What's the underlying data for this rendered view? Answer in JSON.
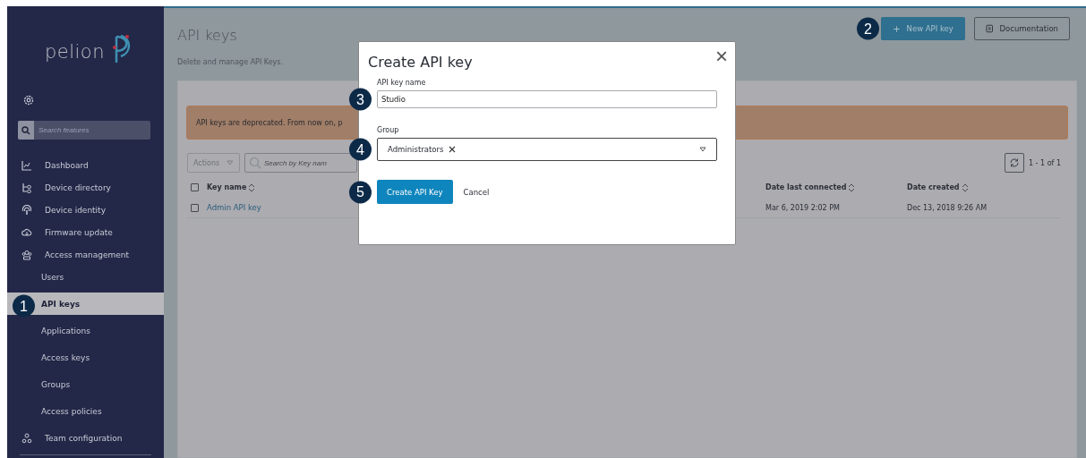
{
  "sidebar": {
    "logo": "pelion",
    "search": {
      "placeholder": "Search features"
    },
    "items": [
      {
        "label": "Dashboard",
        "selected": false
      },
      {
        "label": "Device directory",
        "selected": false
      },
      {
        "label": "Device identity",
        "selected": false
      },
      {
        "label": "Firmware update",
        "selected": false
      },
      {
        "label": "Access management",
        "selected": false,
        "children": [
          {
            "label": "Users",
            "selected": false
          },
          {
            "label": "API keys",
            "selected": true,
            "callout": "1"
          },
          {
            "label": "Applications",
            "selected": false
          },
          {
            "label": "Access keys",
            "selected": false
          },
          {
            "label": "Groups",
            "selected": false
          },
          {
            "label": "Access policies",
            "selected": false
          }
        ]
      },
      {
        "label": "Team configuration",
        "selected": false
      }
    ]
  },
  "header": {
    "title": "API keys",
    "subtitle": "Delete and manage API Keys.",
    "buttons": [
      {
        "label": "New API key",
        "kind": "primary",
        "icon": "+",
        "callout": "2"
      },
      {
        "label": "Documentation",
        "kind": "secondary"
      }
    ]
  },
  "warning": "API keys are deprecated. From now on, p",
  "toolbar": {
    "actions": "Actions",
    "search": {
      "placeholder": "Search by Key nam"
    },
    "pagination": "1 - 1 of 1"
  },
  "table": {
    "all_checked": false,
    "columns": [
      {
        "label": "Key name"
      },
      {
        "label": "Date last connected"
      },
      {
        "label": "Date created"
      }
    ],
    "rows": [
      {
        "checked": false,
        "cells": [
          "Admin API key",
          "Mar 6, 2019 2:02 PM",
          "Dec 13, 2018 9:26 AM"
        ]
      }
    ]
  },
  "dialog": {
    "title": "Create API key",
    "close": "×",
    "fields": [
      {
        "kind": "text",
        "label": "API key name",
        "value": "Studio",
        "callout": "3"
      },
      {
        "kind": "select",
        "label": "Group",
        "tags": [
          "Administrators"
        ],
        "callout": "4"
      }
    ],
    "buttons": [
      {
        "label": "Create API Key",
        "kind": "primary",
        "callout": "5"
      },
      {
        "label": "Cancel",
        "kind": "link"
      }
    ]
  }
}
